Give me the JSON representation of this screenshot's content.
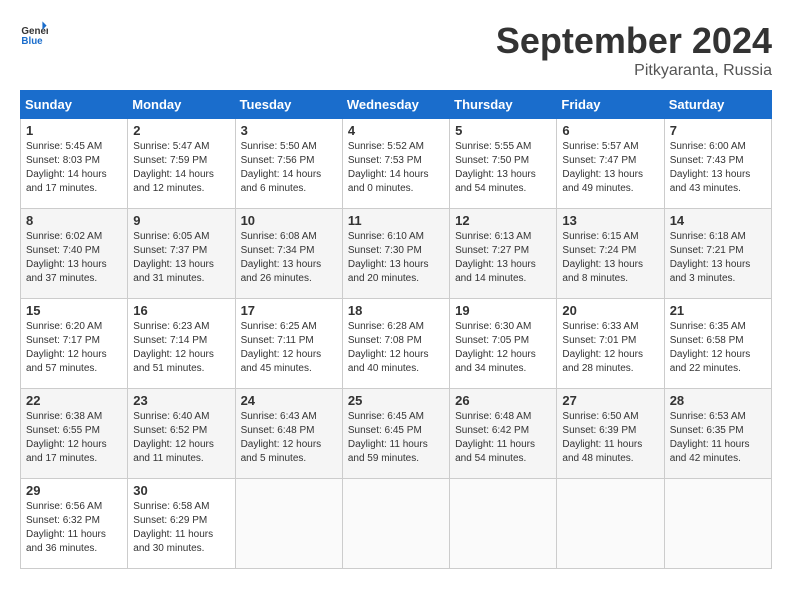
{
  "header": {
    "logo_general": "General",
    "logo_blue": "Blue",
    "month": "September 2024",
    "location": "Pitkyaranta, Russia"
  },
  "weekdays": [
    "Sunday",
    "Monday",
    "Tuesday",
    "Wednesday",
    "Thursday",
    "Friday",
    "Saturday"
  ],
  "weeks": [
    [
      {
        "day": "1",
        "info": "Sunrise: 5:45 AM\nSunset: 8:03 PM\nDaylight: 14 hours\nand 17 minutes."
      },
      {
        "day": "2",
        "info": "Sunrise: 5:47 AM\nSunset: 7:59 PM\nDaylight: 14 hours\nand 12 minutes."
      },
      {
        "day": "3",
        "info": "Sunrise: 5:50 AM\nSunset: 7:56 PM\nDaylight: 14 hours\nand 6 minutes."
      },
      {
        "day": "4",
        "info": "Sunrise: 5:52 AM\nSunset: 7:53 PM\nDaylight: 14 hours\nand 0 minutes."
      },
      {
        "day": "5",
        "info": "Sunrise: 5:55 AM\nSunset: 7:50 PM\nDaylight: 13 hours\nand 54 minutes."
      },
      {
        "day": "6",
        "info": "Sunrise: 5:57 AM\nSunset: 7:47 PM\nDaylight: 13 hours\nand 49 minutes."
      },
      {
        "day": "7",
        "info": "Sunrise: 6:00 AM\nSunset: 7:43 PM\nDaylight: 13 hours\nand 43 minutes."
      }
    ],
    [
      {
        "day": "8",
        "info": "Sunrise: 6:02 AM\nSunset: 7:40 PM\nDaylight: 13 hours\nand 37 minutes."
      },
      {
        "day": "9",
        "info": "Sunrise: 6:05 AM\nSunset: 7:37 PM\nDaylight: 13 hours\nand 31 minutes."
      },
      {
        "day": "10",
        "info": "Sunrise: 6:08 AM\nSunset: 7:34 PM\nDaylight: 13 hours\nand 26 minutes."
      },
      {
        "day": "11",
        "info": "Sunrise: 6:10 AM\nSunset: 7:30 PM\nDaylight: 13 hours\nand 20 minutes."
      },
      {
        "day": "12",
        "info": "Sunrise: 6:13 AM\nSunset: 7:27 PM\nDaylight: 13 hours\nand 14 minutes."
      },
      {
        "day": "13",
        "info": "Sunrise: 6:15 AM\nSunset: 7:24 PM\nDaylight: 13 hours\nand 8 minutes."
      },
      {
        "day": "14",
        "info": "Sunrise: 6:18 AM\nSunset: 7:21 PM\nDaylight: 13 hours\nand 3 minutes."
      }
    ],
    [
      {
        "day": "15",
        "info": "Sunrise: 6:20 AM\nSunset: 7:17 PM\nDaylight: 12 hours\nand 57 minutes."
      },
      {
        "day": "16",
        "info": "Sunrise: 6:23 AM\nSunset: 7:14 PM\nDaylight: 12 hours\nand 51 minutes."
      },
      {
        "day": "17",
        "info": "Sunrise: 6:25 AM\nSunset: 7:11 PM\nDaylight: 12 hours\nand 45 minutes."
      },
      {
        "day": "18",
        "info": "Sunrise: 6:28 AM\nSunset: 7:08 PM\nDaylight: 12 hours\nand 40 minutes."
      },
      {
        "day": "19",
        "info": "Sunrise: 6:30 AM\nSunset: 7:05 PM\nDaylight: 12 hours\nand 34 minutes."
      },
      {
        "day": "20",
        "info": "Sunrise: 6:33 AM\nSunset: 7:01 PM\nDaylight: 12 hours\nand 28 minutes."
      },
      {
        "day": "21",
        "info": "Sunrise: 6:35 AM\nSunset: 6:58 PM\nDaylight: 12 hours\nand 22 minutes."
      }
    ],
    [
      {
        "day": "22",
        "info": "Sunrise: 6:38 AM\nSunset: 6:55 PM\nDaylight: 12 hours\nand 17 minutes."
      },
      {
        "day": "23",
        "info": "Sunrise: 6:40 AM\nSunset: 6:52 PM\nDaylight: 12 hours\nand 11 minutes."
      },
      {
        "day": "24",
        "info": "Sunrise: 6:43 AM\nSunset: 6:48 PM\nDaylight: 12 hours\nand 5 minutes."
      },
      {
        "day": "25",
        "info": "Sunrise: 6:45 AM\nSunset: 6:45 PM\nDaylight: 11 hours\nand 59 minutes."
      },
      {
        "day": "26",
        "info": "Sunrise: 6:48 AM\nSunset: 6:42 PM\nDaylight: 11 hours\nand 54 minutes."
      },
      {
        "day": "27",
        "info": "Sunrise: 6:50 AM\nSunset: 6:39 PM\nDaylight: 11 hours\nand 48 minutes."
      },
      {
        "day": "28",
        "info": "Sunrise: 6:53 AM\nSunset: 6:35 PM\nDaylight: 11 hours\nand 42 minutes."
      }
    ],
    [
      {
        "day": "29",
        "info": "Sunrise: 6:56 AM\nSunset: 6:32 PM\nDaylight: 11 hours\nand 36 minutes."
      },
      {
        "day": "30",
        "info": "Sunrise: 6:58 AM\nSunset: 6:29 PM\nDaylight: 11 hours\nand 30 minutes."
      },
      {
        "day": "",
        "info": ""
      },
      {
        "day": "",
        "info": ""
      },
      {
        "day": "",
        "info": ""
      },
      {
        "day": "",
        "info": ""
      },
      {
        "day": "",
        "info": ""
      }
    ]
  ]
}
